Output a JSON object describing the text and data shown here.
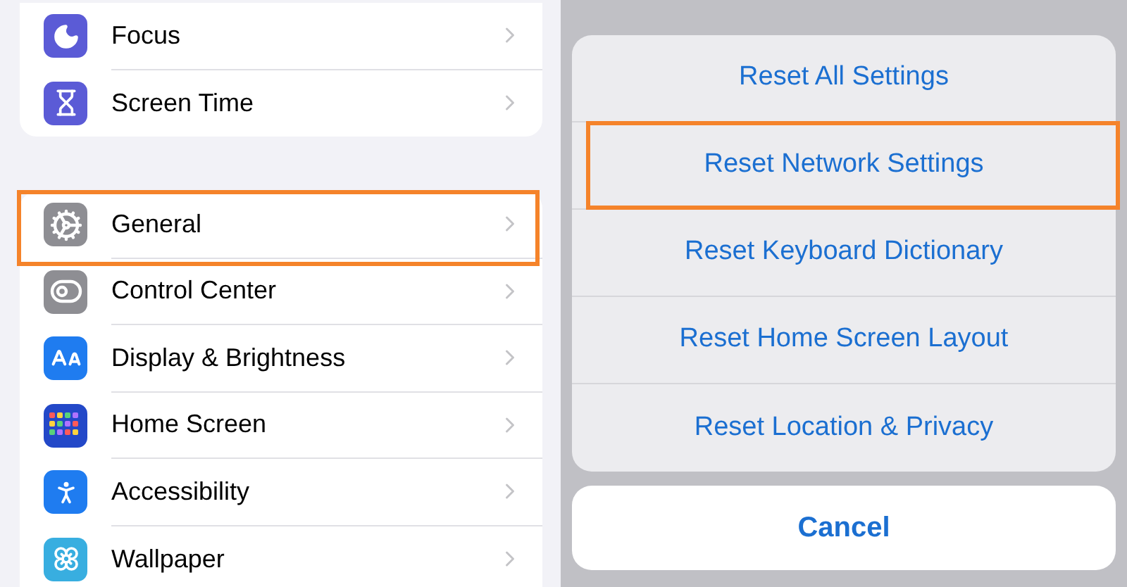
{
  "settings_groups": [
    {
      "items": [
        {
          "label": "Focus",
          "kind": "moon",
          "color": "#5b5bd6",
          "highlighted": false
        },
        {
          "label": "Screen Time",
          "kind": "hourglass",
          "color": "#5b5bd6",
          "highlighted": false
        }
      ]
    },
    {
      "items": [
        {
          "label": "General",
          "kind": "gear",
          "color": "#8e8e93",
          "highlighted": true
        },
        {
          "label": "Control Center",
          "kind": "toggles",
          "color": "#8e8e93",
          "highlighted": false
        },
        {
          "label": "Display & Brightness",
          "kind": "letters",
          "color": "#1f7cf0",
          "highlighted": false
        },
        {
          "label": "Home Screen",
          "kind": "grid",
          "color": "#2348c8",
          "highlighted": false
        },
        {
          "label": "Accessibility",
          "kind": "person",
          "color": "#1f7cf0",
          "highlighted": false
        },
        {
          "label": "Wallpaper",
          "kind": "flower",
          "color": "#38aee0",
          "highlighted": false
        }
      ]
    }
  ],
  "action_sheet": {
    "actions": [
      {
        "label": "Reset All Settings",
        "highlighted": false
      },
      {
        "label": "Reset Network Settings",
        "highlighted": true
      },
      {
        "label": "Reset Keyboard Dictionary",
        "highlighted": false
      },
      {
        "label": "Reset Home Screen Layout",
        "highlighted": false
      },
      {
        "label": "Reset Location & Privacy",
        "highlighted": false
      }
    ],
    "cancel": "Cancel"
  }
}
